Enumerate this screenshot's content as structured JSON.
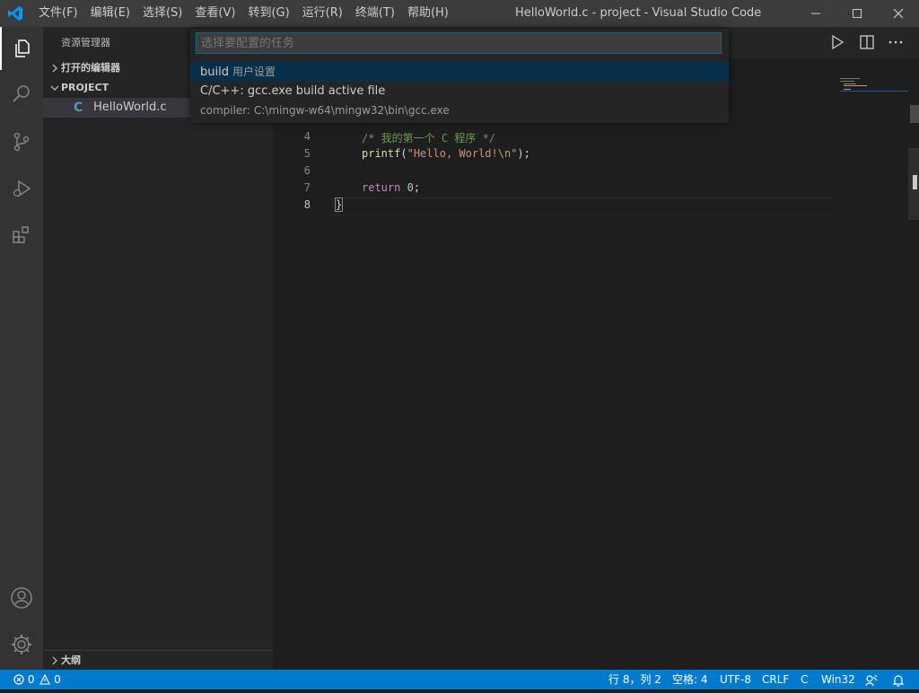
{
  "window": {
    "title": "HelloWorld.c - project - Visual Studio Code",
    "menu": [
      "文件(F)",
      "编辑(E)",
      "选择(S)",
      "查看(V)",
      "转到(G)",
      "运行(R)",
      "终端(T)",
      "帮助(H)"
    ]
  },
  "sidebar": {
    "title": "资源管理器",
    "open_editors": "打开的编辑器",
    "project": "PROJECT",
    "file_icon": "C",
    "file": "HelloWorld.c",
    "outline": "大纲"
  },
  "editor": {
    "lines": [
      {
        "num": "4",
        "text": "/* 我的第一个 C 程序 */"
      },
      {
        "num": "5",
        "fn": "printf",
        "open": "(",
        "str": "\"Hello, World!\\n\"",
        "close": ");"
      },
      {
        "num": "6",
        "text": ""
      },
      {
        "num": "7",
        "kw": "return",
        "sp": " ",
        "val": "0",
        "end": ";"
      },
      {
        "num": "8",
        "text": "}"
      }
    ]
  },
  "quickpick": {
    "placeholder": "选择要配置的任务",
    "items": [
      {
        "label": "build",
        "desc": "用户设置"
      },
      {
        "label": "C/C++: gcc.exe build active file"
      }
    ],
    "detail": "compiler: C:\\mingw-w64\\mingw32\\bin\\gcc.exe"
  },
  "statusbar": {
    "errors": "0",
    "warnings": "0",
    "position": "行 8，列 2",
    "spaces": "空格: 4",
    "encoding": "UTF-8",
    "eol": "CRLF",
    "language": "C",
    "platform": "Win32"
  },
  "colors": {
    "accent": "#007acc",
    "comment": "#6a9955",
    "function": "#dcdcaa",
    "string": "#ce9178",
    "keyword": "#c586c0",
    "number": "#b5cea8"
  }
}
